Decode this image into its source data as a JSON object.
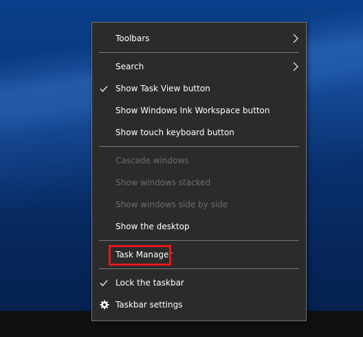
{
  "desktop": {
    "background_color": "#0a3578",
    "taskbar_color": "#101010"
  },
  "context_menu": {
    "background_color": "#2b2b2b",
    "items": [
      {
        "label": "Toolbars",
        "enabled": true,
        "checked": false,
        "submenu": true,
        "icon": "chevron-right-icon"
      },
      {
        "label": "Search",
        "enabled": true,
        "checked": false,
        "submenu": true,
        "icon": "chevron-right-icon"
      },
      {
        "label": "Show Task View button",
        "enabled": true,
        "checked": true,
        "submenu": false,
        "icon": "checkmark-icon"
      },
      {
        "label": "Show Windows Ink Workspace button",
        "enabled": true,
        "checked": false,
        "submenu": false
      },
      {
        "label": "Show touch keyboard button",
        "enabled": true,
        "checked": false,
        "submenu": false
      },
      {
        "label": "Cascade windows",
        "enabled": false,
        "checked": false,
        "submenu": false
      },
      {
        "label": "Show windows stacked",
        "enabled": false,
        "checked": false,
        "submenu": false
      },
      {
        "label": "Show windows side by side",
        "enabled": false,
        "checked": false,
        "submenu": false
      },
      {
        "label": "Show the desktop",
        "enabled": true,
        "checked": false,
        "submenu": false
      },
      {
        "label": "Task Manager",
        "enabled": true,
        "checked": false,
        "submenu": false,
        "highlighted": true
      },
      {
        "label": "Lock the taskbar",
        "enabled": true,
        "checked": true,
        "submenu": false,
        "icon": "checkmark-icon"
      },
      {
        "label": "Taskbar settings",
        "enabled": true,
        "checked": false,
        "submenu": false,
        "icon": "gear-icon"
      }
    ],
    "highlight_color": "#e8141e"
  }
}
